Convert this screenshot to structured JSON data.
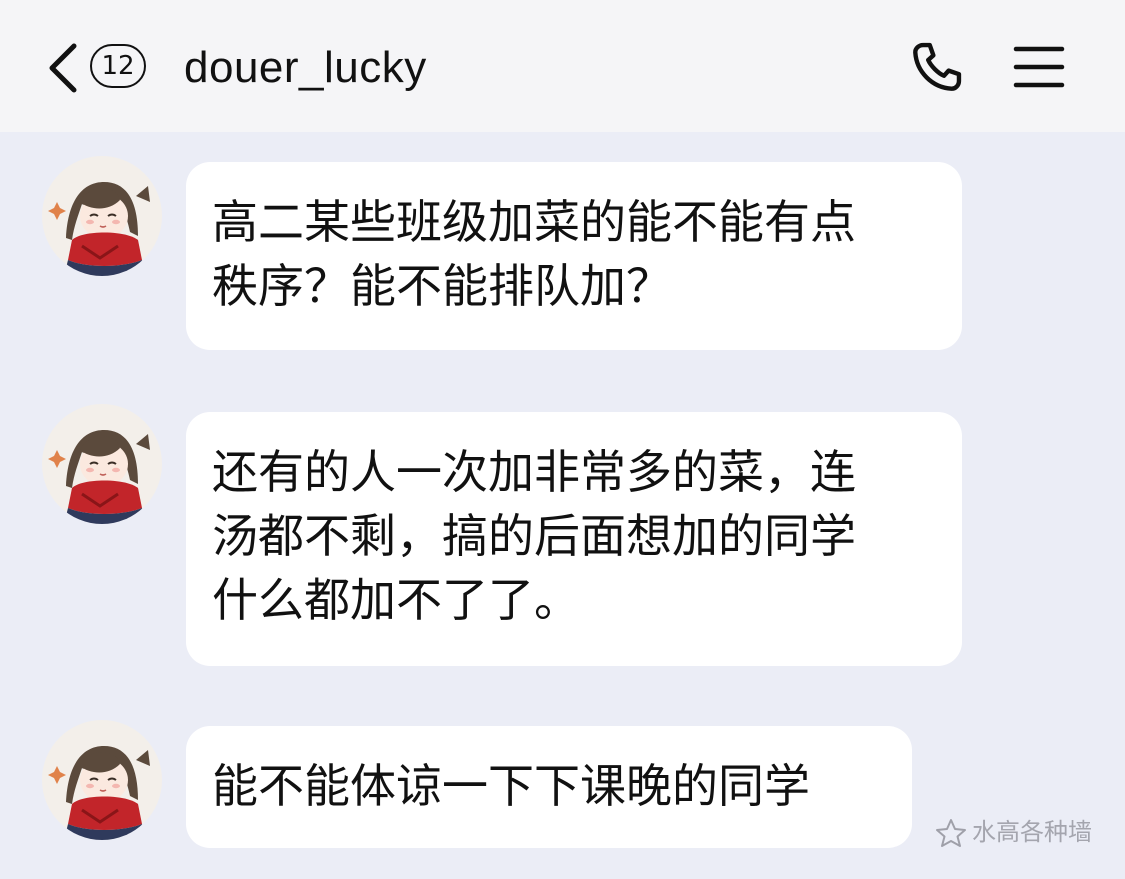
{
  "header": {
    "back_label": "Back",
    "unread_count": "12",
    "contact_name": "douer_lucky"
  },
  "messages": [
    {
      "lines": [
        "高二某些班级加菜的能不能有点",
        "秩序？能不能排队加？"
      ]
    },
    {
      "lines": [
        "还有的人一次加非常多的菜，连",
        "汤都不剩，搞的后面想加的同学",
        "什么都加不了了。"
      ]
    },
    {
      "lines": [
        "能不能体谅一下下课晚的同学"
      ]
    }
  ],
  "watermark": {
    "text": "水高各种墙"
  },
  "colors": {
    "background": "#ebedf6",
    "header": "#f5f5f7",
    "bubble": "#ffffff",
    "text": "#111111"
  }
}
